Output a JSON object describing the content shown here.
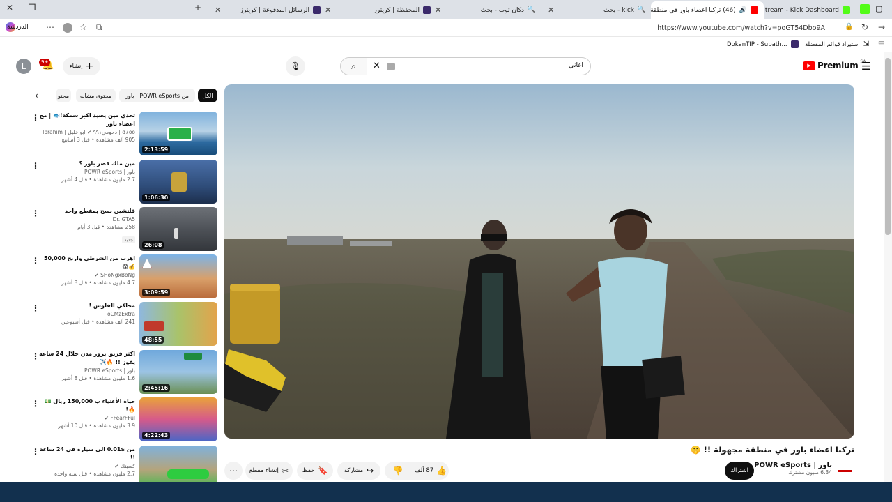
{
  "browser": {
    "tabs": [
      {
        "title": "Stream - Kick Dashboard",
        "active": false
      },
      {
        "title": "(46) تركنا اعضاء باور في منطقة",
        "active": true
      },
      {
        "title": "دكان توب - بحث",
        "active": false
      },
      {
        "title": "kick - بحث",
        "active": false
      },
      {
        "title": "المحفظة | كريترز",
        "active": false
      },
      {
        "title": "الرسائل المدفوعة | كريترز",
        "active": false
      }
    ],
    "url": "https://www.youtube.com/watch?v=poGT54Dbo9A",
    "chat_label": "الدردشة",
    "bookmarks": {
      "import_label": "استيراد قوائم المفضلة",
      "dokan": "DokanTIP - Subath..."
    }
  },
  "youtube": {
    "logo_text": "Premium",
    "region": "SA",
    "search_value": "اغاني",
    "create_label": "إنشاء",
    "notif_count": "9+",
    "avatar_letter": "L"
  },
  "chips": [
    "الكل",
    "من POWR eSports | باور",
    "محتوى مشابه",
    "محتو"
  ],
  "sidebar": [
    {
      "title": "تحدي مين يصيد اكبر سمكة!🐟 | مع اعضاء باور",
      "channel": "d7oo | دحومي٩٩١ ✔ ابو خليل | Ibrahim",
      "meta": "905 ألف مشاهدة • قبل 3 أسابيع",
      "duration": "2:13:59",
      "badge": ""
    },
    {
      "title": "مين ملك قصر باور ؟",
      "channel": "باور | POWR eSports",
      "meta": "2.7 مليون مشاهدة • قبل 4 أشهر",
      "duration": "1:06:30",
      "badge": ""
    },
    {
      "title": "قلتشين نسخ بمقطع واحد",
      "channel": "Dr. GTA5",
      "meta": "258 مشاهدة • قبل 3 أيام",
      "duration": "26:08",
      "badge": "جديد"
    },
    {
      "title": "اهرب من الشرطي واربح 50,000 💰😱",
      "channel": "SHoNgxBoNg ✔",
      "meta": "4.7 مليون مشاهدة • قبل 8 أشهر",
      "duration": "3:09:59",
      "badge": ""
    },
    {
      "title": "محاكي الفلوس !",
      "channel": "oCMzExtra",
      "meta": "241 ألف مشاهدة • قبل أسبوعين",
      "duration": "48:55",
      "badge": ""
    },
    {
      "title": "اكثر فريق يزور مدن خلال 24 ساعة يفوز !! 🔥✈️",
      "channel": "باور | POWR eSports",
      "meta": "1.6 مليون مشاهدة • قبل 8 أشهر",
      "duration": "2:45:16",
      "badge": ""
    },
    {
      "title": "حياة الأغنياء ب 150,000 ريال 💵🔥!",
      "channel": "FFearFFul ✔",
      "meta": "3.9 مليون مشاهدة • قبل 10 أشهر",
      "duration": "4:22:43",
      "badge": ""
    },
    {
      "title": "من $0.01 الى سيارة في 24 ساعة !!",
      "channel": "كسبتك ✔",
      "meta": "2.7 مليون مشاهدة • قبل سنة واحدة",
      "duration": "",
      "badge": ""
    }
  ],
  "video": {
    "title": "تركنا اعضاء باور في منطقة مجهولة !! 🤫",
    "channel": "باور | POWR eSports",
    "subs": "6.34 مليون مشترك",
    "subscribe": "اشتراك",
    "likes": "87 ألف",
    "share": "مشاركة",
    "save": "حفظ",
    "clip": "إنشاء مقطع"
  },
  "colors": {
    "yt_red": "#ff0000",
    "taskbar": "#12304e"
  }
}
